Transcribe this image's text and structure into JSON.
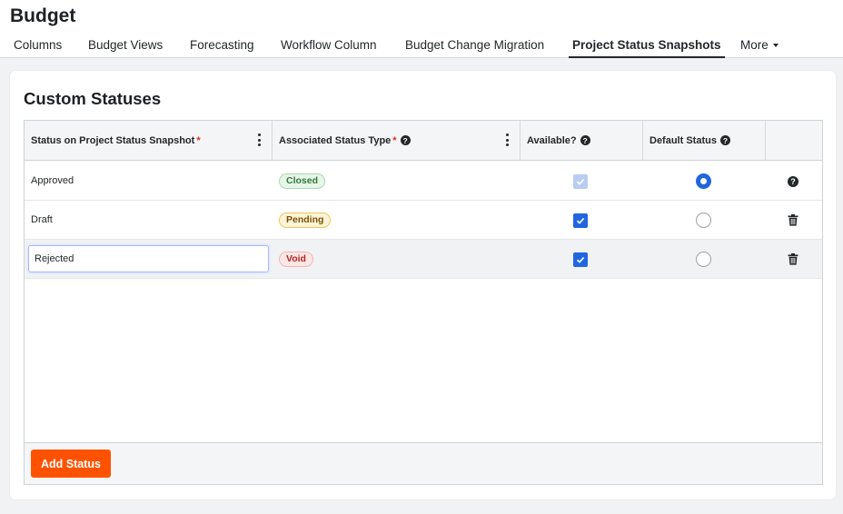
{
  "app": {
    "title": "Budget"
  },
  "tabs": [
    {
      "label": "Columns"
    },
    {
      "label": "Budget Views"
    },
    {
      "label": "Forecasting"
    },
    {
      "label": "Workflow Column"
    },
    {
      "label": "Budget Change Migration"
    },
    {
      "label": "Project Status Snapshots",
      "active": true
    },
    {
      "label": "More"
    }
  ],
  "section": {
    "title": "Custom Statuses"
  },
  "table": {
    "columns": [
      {
        "label": "Status on Project Status Snapshot",
        "required": true
      },
      {
        "label": "Associated Status Type",
        "required": true,
        "help": true
      },
      {
        "label": "Available?",
        "help": true
      },
      {
        "label": "Default Status",
        "help": true
      }
    ],
    "rows": [
      {
        "name": "Approved",
        "type": "Closed",
        "available": true,
        "available_disabled": true,
        "default": true,
        "action": "help-icon"
      },
      {
        "name": "Draft",
        "type": "Pending",
        "available": true,
        "default": false,
        "action": "trash-icon"
      },
      {
        "name": "Rejected",
        "type": "Void",
        "available": true,
        "default": false,
        "action": "trash-icon",
        "editing": true
      }
    ]
  },
  "actions": {
    "add_status": "Add Status"
  },
  "colors": {
    "accent": "#ff5200",
    "checkbox": "#2066df",
    "closed": "#2d7a36",
    "pending": "#7a5300",
    "void": "#b2261e"
  }
}
